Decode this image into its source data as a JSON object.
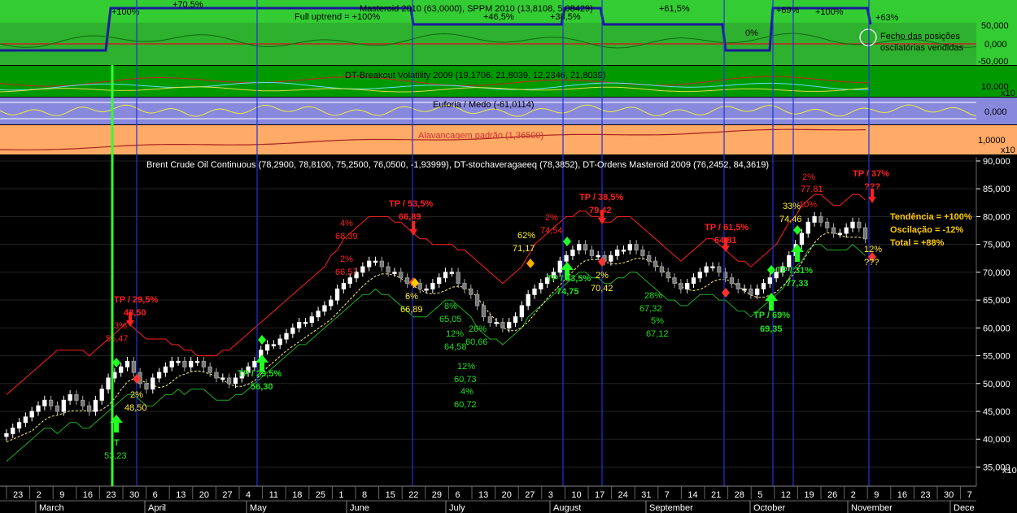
{
  "colors": {
    "uptrend_bg": "#33cc33",
    "uptrend_dark": "#2a9a2a",
    "breakout_bg": "#009900",
    "euforia_bg": "#8888dd",
    "alav_bg": "#ffaa66",
    "main_bg": "#000000",
    "vline": "#2233dd",
    "greenline": "#33ff33",
    "red": "#ff2020",
    "green": "#22dd22",
    "yellow": "#ffee33"
  },
  "panels": {
    "uptrend": {
      "title": "Masteroid 2010 (63,0000), SPPM 2010 (13,8108, 5,08429)",
      "subtitle": "Full uptrend = +100%",
      "percents": [
        "+100%",
        "+70,5%",
        "+46,5%",
        "+38,5%",
        "+61,5%",
        "0%",
        "+69%",
        "+100%",
        "+63%"
      ],
      "note_line1": "Fecho das posições",
      "note_line2": "oscilatórias vendidas",
      "scale": [
        "50,000",
        "0,000",
        "-50,000"
      ]
    },
    "breakout": {
      "title": "DT-Breakout Volatility 2009 (19,1706, 21,8039, 12,2346, 21,8039)",
      "scale": [
        "10,000"
      ],
      "scale_suffix": "x10"
    },
    "euforia": {
      "title": "Euforia / Medo (-61,0114)",
      "scale": [
        "0,000"
      ]
    },
    "alavancagem": {
      "title": "Alavancagem padrão (1,36500)",
      "scale": [
        "1,0000"
      ],
      "scale_suffix": "x10"
    }
  },
  "main": {
    "title": "Brent Crude Oil Continuous (78,2900, 78,8100, 75,2500, 76,0500, -1,93999), DT-stochaveragaeeq (78,3852), DT-Ordens Masteroid 2009 (76,2452, 84,3619)",
    "summary": {
      "tendencia": "Tendência = +100%",
      "oscilacao": "Oscilação = -12%",
      "total": "Total = +88%"
    },
    "scale_suffix": "x10"
  },
  "x_axis": {
    "days": [
      "23",
      "2",
      "9",
      "16",
      "23",
      "30",
      "6",
      "13",
      "20",
      "27",
      "4",
      "11",
      "18",
      "25",
      "1",
      "8",
      "15",
      "22",
      "29",
      "6",
      "13",
      "20",
      "27",
      "3",
      "10",
      "17",
      "24",
      "31",
      "7",
      "14",
      "21",
      "28",
      "5",
      "12",
      "19",
      "26",
      "2",
      "9",
      "16",
      "23",
      "30",
      "7"
    ],
    "months": [
      "March",
      "April",
      "May",
      "June",
      "July",
      "August",
      "September",
      "October",
      "November",
      "Dece"
    ]
  },
  "chart_data": {
    "type": "candlestick",
    "title": "Brent Crude Oil Continuous (78,2900, 78,8100, 75,2500, 76,0500, -1,93999), DT-stochaveragaeeq (78,3852), DT-Ordens Masteroid 2009 (76,2452, 84,3619)",
    "y_ticks": [
      "90,000",
      "85,000",
      "80,000",
      "75,000",
      "70,000",
      "65,000",
      "60,000",
      "55,000",
      "50,000",
      "45,000",
      "40,000",
      "35,000"
    ],
    "ylim": [
      32,
      90
    ],
    "close": [
      41,
      42,
      43,
      44,
      45,
      46,
      47,
      46,
      45,
      47,
      48,
      47,
      46,
      45,
      47,
      49,
      51,
      52,
      53,
      54,
      52,
      50,
      49,
      51,
      52,
      53,
      54,
      54,
      53,
      54,
      54,
      53,
      52,
      51,
      51,
      50,
      51,
      52,
      53,
      54,
      56,
      57,
      57,
      58,
      59,
      60,
      61,
      61,
      62,
      63,
      64,
      65,
      67,
      68,
      69,
      70,
      71,
      72,
      72,
      71,
      70,
      70,
      69,
      68,
      68,
      67,
      67,
      68,
      69,
      70,
      70,
      68,
      67,
      66,
      64,
      62,
      61,
      61,
      60,
      61,
      62,
      64,
      66,
      67,
      68,
      69,
      70,
      72,
      73,
      74,
      75,
      74,
      73,
      73,
      72,
      73,
      74,
      74,
      75,
      74,
      73,
      72,
      71,
      70,
      69,
      68,
      67,
      68,
      69,
      70,
      71,
      71,
      70,
      69,
      68,
      67,
      67,
      66,
      67,
      68,
      69,
      70,
      71,
      73,
      75,
      77,
      79,
      80,
      79,
      78,
      77,
      77,
      78,
      79,
      78,
      76
    ],
    "upper_band": [
      48,
      49,
      50,
      51,
      52,
      53,
      54,
      55,
      56,
      56,
      56,
      56,
      56,
      55,
      56,
      57,
      58,
      59,
      60,
      61,
      60,
      59,
      58,
      58,
      58,
      58,
      57,
      57,
      56,
      56,
      55,
      55,
      55,
      55,
      56,
      56,
      57,
      58,
      59,
      60,
      61,
      62,
      63,
      64,
      65,
      66,
      67,
      68,
      69,
      70,
      71,
      73,
      74,
      76,
      77,
      78,
      79,
      80,
      80,
      80,
      80,
      79,
      79,
      78,
      77,
      76,
      76,
      75,
      75,
      75,
      75,
      74,
      74,
      73,
      72,
      71,
      70,
      69,
      68,
      69,
      70,
      71,
      73,
      75,
      76,
      77,
      78,
      79,
      80,
      80,
      81,
      81,
      80,
      80,
      79,
      79,
      80,
      80,
      80,
      79,
      78,
      77,
      76,
      75,
      74,
      73,
      72,
      73,
      74,
      75,
      76,
      76,
      75,
      74,
      73,
      72,
      72,
      71,
      72,
      73,
      74,
      75,
      77,
      79,
      80,
      82,
      83,
      84,
      84,
      83,
      82,
      82,
      83,
      84,
      84,
      83
    ],
    "lower_band": [
      36,
      37,
      38,
      39,
      40,
      41,
      42,
      42,
      41,
      42,
      43,
      43,
      42,
      42,
      43,
      44,
      45,
      46,
      47,
      48,
      48,
      47,
      46,
      46,
      47,
      48,
      48,
      49,
      48,
      49,
      49,
      49,
      48,
      47,
      47,
      47,
      48,
      48,
      49,
      50,
      51,
      52,
      53,
      54,
      55,
      56,
      57,
      57,
      58,
      59,
      60,
      61,
      62,
      63,
      64,
      65,
      66,
      66,
      67,
      66,
      66,
      65,
      64,
      63,
      62,
      62,
      62,
      63,
      64,
      65,
      65,
      64,
      63,
      62,
      60,
      59,
      58,
      58,
      57,
      58,
      59,
      60,
      62,
      63,
      64,
      65,
      66,
      67,
      68,
      69,
      70,
      70,
      69,
      69,
      68,
      68,
      69,
      69,
      70,
      70,
      69,
      68,
      67,
      66,
      65,
      65,
      64,
      64,
      65,
      66,
      66,
      66,
      65,
      65,
      64,
      63,
      63,
      62,
      63,
      64,
      65,
      66,
      67,
      69,
      71,
      72,
      74,
      75,
      75,
      74,
      74,
      74,
      74,
      75,
      74,
      73
    ],
    "signal_labels": [
      {
        "text": "TP / 29,5%",
        "color": "red",
        "x": 140,
        "y": 372
      },
      {
        "text": "48,50",
        "color": "red",
        "x": 152,
        "y": 388
      },
      {
        "text": "55,47",
        "color": "red",
        "x": 130,
        "y": 420
      },
      {
        "text": "3%",
        "color": "red",
        "x": 140,
        "y": 404
      },
      {
        "text": "2%",
        "color": "yellow",
        "x": 160,
        "y": 489
      },
      {
        "text": "48,50",
        "color": "yellow",
        "x": 153,
        "y": 505
      },
      {
        "text": "T",
        "color": "green",
        "x": 140,
        "y": 548
      },
      {
        "text": "53,23",
        "color": "green",
        "x": 128,
        "y": 564
      },
      {
        "text": "TP / 29,5%",
        "color": "green",
        "x": 292,
        "y": 463
      },
      {
        "text": "56,30",
        "color": "green",
        "x": 308,
        "y": 479
      },
      {
        "text": "4%",
        "color": "red",
        "x": 418,
        "y": 278
      },
      {
        "text": "68,39",
        "color": "red",
        "x": 412,
        "y": 294
      },
      {
        "text": "2%",
        "color": "red",
        "x": 418,
        "y": 322
      },
      {
        "text": "66,57",
        "color": "red",
        "x": 412,
        "y": 338
      },
      {
        "text": "TP / 53,5%",
        "color": "red",
        "x": 478,
        "y": 254
      },
      {
        "text": "66,89",
        "color": "red",
        "x": 490,
        "y": 270
      },
      {
        "text": "6%",
        "color": "yellow",
        "x": 498,
        "y": 368
      },
      {
        "text": "66,89",
        "color": "yellow",
        "x": 492,
        "y": 384
      },
      {
        "text": "8%",
        "color": "green",
        "x": 546,
        "y": 380
      },
      {
        "text": "65,05",
        "color": "green",
        "x": 540,
        "y": 396
      },
      {
        "text": "12%",
        "color": "green",
        "x": 548,
        "y": 414
      },
      {
        "text": "64,58",
        "color": "green",
        "x": 546,
        "y": 430
      },
      {
        "text": "26%",
        "color": "green",
        "x": 576,
        "y": 408
      },
      {
        "text": "60,66",
        "color": "green",
        "x": 572,
        "y": 424
      },
      {
        "text": "12%",
        "color": "green",
        "x": 562,
        "y": 454
      },
      {
        "text": "60,73",
        "color": "green",
        "x": 558,
        "y": 470
      },
      {
        "text": "4%",
        "color": "green",
        "x": 566,
        "y": 485
      },
      {
        "text": "60,72",
        "color": "green",
        "x": 558,
        "y": 501
      },
      {
        "text": "62%",
        "color": "yellow",
        "x": 636,
        "y": 293
      },
      {
        "text": "71,17",
        "color": "yellow",
        "x": 630,
        "y": 309
      },
      {
        "text": "2%",
        "color": "red",
        "x": 670,
        "y": 271
      },
      {
        "text": "74,54",
        "color": "red",
        "x": 664,
        "y": 287
      },
      {
        "text": "TP / 53,5%",
        "color": "green",
        "x": 672,
        "y": 346
      },
      {
        "text": "74,75",
        "color": "green",
        "x": 684,
        "y": 362
      },
      {
        "text": "TP / 38,5%",
        "color": "red",
        "x": 712,
        "y": 246
      },
      {
        "text": "79,42",
        "color": "red",
        "x": 724,
        "y": 262
      },
      {
        "text": "2%",
        "color": "yellow",
        "x": 732,
        "y": 342
      },
      {
        "text": "70,42",
        "color": "yellow",
        "x": 726,
        "y": 358
      },
      {
        "text": "28%",
        "color": "green",
        "x": 792,
        "y": 367
      },
      {
        "text": "67,32",
        "color": "green",
        "x": 786,
        "y": 383
      },
      {
        "text": "5%",
        "color": "green",
        "x": 800,
        "y": 398
      },
      {
        "text": "67,12",
        "color": "green",
        "x": 794,
        "y": 414
      },
      {
        "text": "TP / 61,5%",
        "color": "red",
        "x": 866,
        "y": 283
      },
      {
        "text": "64,81",
        "color": "red",
        "x": 878,
        "y": 299
      },
      {
        "text": "TP / 69%",
        "color": "green",
        "x": 926,
        "y": 391
      },
      {
        "text": "69,35",
        "color": "green",
        "x": 934,
        "y": 408
      },
      {
        "text": "TP / 31%",
        "color": "green",
        "x": 954,
        "y": 336
      },
      {
        "text": "77,33",
        "color": "green",
        "x": 966,
        "y": 352
      },
      {
        "text": "33%",
        "color": "yellow",
        "x": 962,
        "y": 257
      },
      {
        "text": "74,46",
        "color": "yellow",
        "x": 958,
        "y": 273
      },
      {
        "text": "2%",
        "color": "red",
        "x": 986,
        "y": 221
      },
      {
        "text": "77,81",
        "color": "red",
        "x": 984,
        "y": 236
      },
      {
        "text": "10%",
        "color": "red",
        "x": 982,
        "y": 255
      },
      {
        "text": "TP / 37%",
        "color": "red",
        "x": 1048,
        "y": 217
      },
      {
        "text": "???",
        "color": "red",
        "x": 1062,
        "y": 233
      },
      {
        "text": "12%",
        "color": "yellow",
        "x": 1062,
        "y": 310
      },
      {
        "text": "???",
        "color": "yellow",
        "x": 1062,
        "y": 326
      }
    ]
  }
}
